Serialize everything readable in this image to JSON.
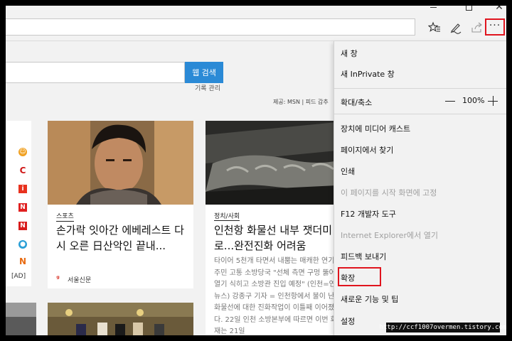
{
  "toolbar": {
    "icons": [
      "favorites-star-icon",
      "pen-notes-icon",
      "share-icon",
      "more-icon"
    ]
  },
  "page": {
    "search_button": "웹 검색",
    "history_link": "기록 관리",
    "provider_text": "제공: MSN | 피드 갑추",
    "ad_label": "[AD]",
    "cards": [
      {
        "category": "스포츠",
        "title": "손가락 잇아간 에베레스트 다시 오른 日산악인 끝내...",
        "source": "서울신문"
      },
      {
        "category": "정치/사회",
        "title": "인천항 화물선 내부 잿더미로...완전진화 어려움",
        "body": "타이어 5천개 타면서 내뿜는 매캐한 연기에 주민 고통 소방당국 \"선체 측면 구멍 뚫어 열기 식히고 소방관 진입 예정\" (인천=연합뉴스) 강종구 기자 = 인천항에서 불이 난 화물선에 대한 진화작업이 이틀째 이어졌다. 22일 인천 소방본부에 따르면 이번 화재는 21일"
      }
    ]
  },
  "menu": {
    "items": [
      {
        "label": "새 창",
        "enabled": true
      },
      {
        "label": "새 InPrivate 창",
        "enabled": true
      },
      {
        "label": "확대/축소",
        "enabled": true
      },
      {
        "label": "장치에 미디어 캐스트",
        "enabled": true
      },
      {
        "label": "페이지에서 찾기",
        "enabled": true
      },
      {
        "label": "인쇄",
        "enabled": true
      },
      {
        "label": "이 페이지를 시작 화면에 고정",
        "enabled": false
      },
      {
        "label": "F12 개발자 도구",
        "enabled": true
      },
      {
        "label": "Internet Explorer에서 열기",
        "enabled": false
      },
      {
        "label": "피드백 보내기",
        "enabled": true
      },
      {
        "label": "확장",
        "enabled": true
      },
      {
        "label": "새로운 기능 및 팁",
        "enabled": true
      },
      {
        "label": "설정",
        "enabled": true
      }
    ],
    "zoom_value": "100%"
  },
  "watermark": "http://ccf1007overmen.tistory.com",
  "colors": {
    "accent_blue": "#2b8ad6",
    "highlight_red": "#e0141e"
  }
}
